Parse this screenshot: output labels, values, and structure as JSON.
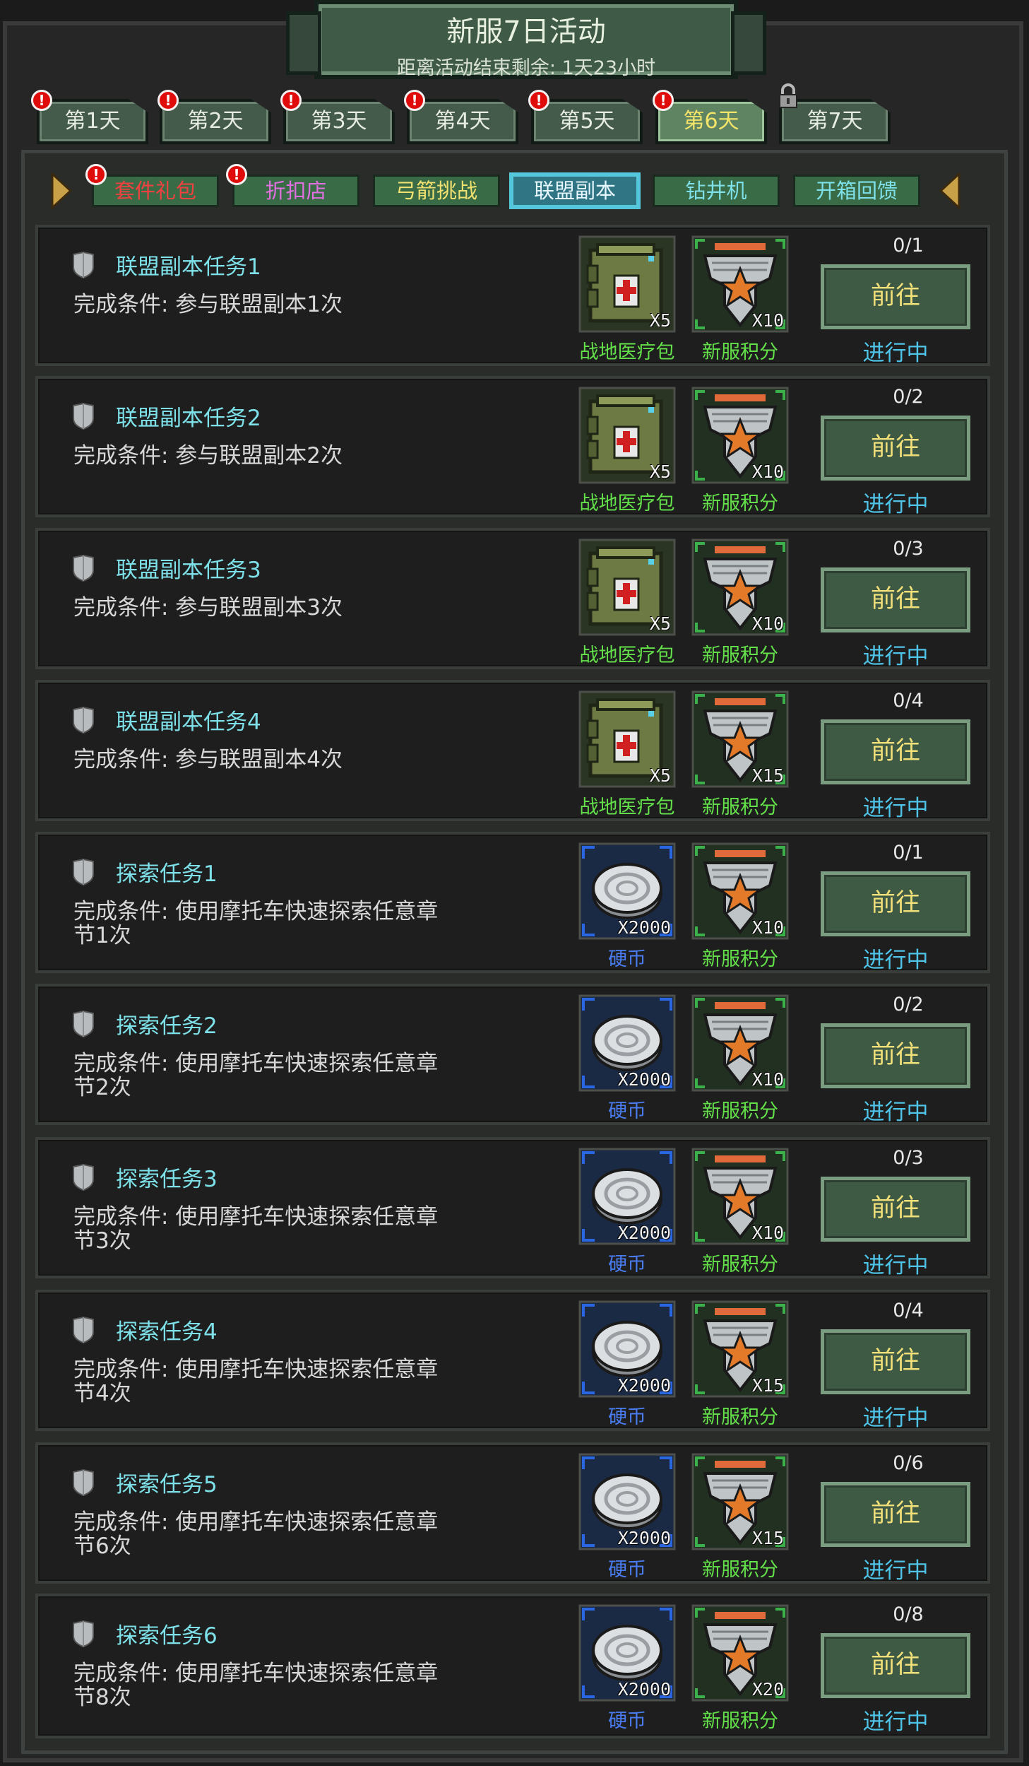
{
  "header": {
    "title": "新服7日活动",
    "countdown": "距离活动结束剩余: 1天23小时"
  },
  "day_tabs": [
    {
      "label": "第1天",
      "alert": true
    },
    {
      "label": "第2天",
      "alert": true
    },
    {
      "label": "第3天",
      "alert": true
    },
    {
      "label": "第4天",
      "alert": true
    },
    {
      "label": "第5天",
      "alert": true
    },
    {
      "label": "第6天",
      "alert": true,
      "active": true
    },
    {
      "label": "第7天",
      "locked": true
    }
  ],
  "alert_mark": "!",
  "sub_tabs": [
    {
      "label": "套件礼包",
      "color": "#f04040",
      "alert": true
    },
    {
      "label": "折扣店",
      "color": "#e070e0",
      "alert": true
    },
    {
      "label": "弓箭挑战",
      "color": "#f0e070"
    },
    {
      "label": "联盟副本",
      "color": "#e8f8ff",
      "active": true
    },
    {
      "label": "钻井机",
      "color": "#7ee0e8"
    },
    {
      "label": "开箱回馈",
      "color": "#7ee0e8"
    }
  ],
  "rewards_meta": {
    "medkit_name": "战地医疗包",
    "points_name": "新服积分",
    "coin_name": "硬币",
    "medkit_name_color": "#63e04a",
    "points_name_color": "#63e04a",
    "coin_name_color": "#4a7cf0"
  },
  "tasks": [
    {
      "name": "联盟副本任务1",
      "condition": "完成条件: 参与联盟副本1次",
      "reward1": {
        "type": "medkit",
        "qty": "X5"
      },
      "reward2": {
        "type": "points",
        "qty": "X10"
      },
      "progress": "0/1",
      "button": "前往",
      "status": "进行中"
    },
    {
      "name": "联盟副本任务2",
      "condition": "完成条件: 参与联盟副本2次",
      "reward1": {
        "type": "medkit",
        "qty": "X5"
      },
      "reward2": {
        "type": "points",
        "qty": "X10"
      },
      "progress": "0/2",
      "button": "前往",
      "status": "进行中"
    },
    {
      "name": "联盟副本任务3",
      "condition": "完成条件: 参与联盟副本3次",
      "reward1": {
        "type": "medkit",
        "qty": "X5"
      },
      "reward2": {
        "type": "points",
        "qty": "X10"
      },
      "progress": "0/3",
      "button": "前往",
      "status": "进行中"
    },
    {
      "name": "联盟副本任务4",
      "condition": "完成条件: 参与联盟副本4次",
      "reward1": {
        "type": "medkit",
        "qty": "X5"
      },
      "reward2": {
        "type": "points",
        "qty": "X15"
      },
      "progress": "0/4",
      "button": "前往",
      "status": "进行中"
    },
    {
      "name": "探索任务1",
      "condition": "完成条件: 使用摩托车快速探索任意章节1次",
      "reward1": {
        "type": "coin",
        "qty": "X2000"
      },
      "reward2": {
        "type": "points",
        "qty": "X10"
      },
      "progress": "0/1",
      "button": "前往",
      "status": "进行中"
    },
    {
      "name": "探索任务2",
      "condition": "完成条件: 使用摩托车快速探索任意章节2次",
      "reward1": {
        "type": "coin",
        "qty": "X2000"
      },
      "reward2": {
        "type": "points",
        "qty": "X10"
      },
      "progress": "0/2",
      "button": "前往",
      "status": "进行中"
    },
    {
      "name": "探索任务3",
      "condition": "完成条件: 使用摩托车快速探索任意章节3次",
      "reward1": {
        "type": "coin",
        "qty": "X2000"
      },
      "reward2": {
        "type": "points",
        "qty": "X10"
      },
      "progress": "0/3",
      "button": "前往",
      "status": "进行中"
    },
    {
      "name": "探索任务4",
      "condition": "完成条件: 使用摩托车快速探索任意章节4次",
      "reward1": {
        "type": "coin",
        "qty": "X2000"
      },
      "reward2": {
        "type": "points",
        "qty": "X15"
      },
      "progress": "0/4",
      "button": "前往",
      "status": "进行中"
    },
    {
      "name": "探索任务5",
      "condition": "完成条件: 使用摩托车快速探索任意章节6次",
      "reward1": {
        "type": "coin",
        "qty": "X2000"
      },
      "reward2": {
        "type": "points",
        "qty": "X15"
      },
      "progress": "0/6",
      "button": "前往",
      "status": "进行中"
    },
    {
      "name": "探索任务6",
      "condition": "完成条件: 使用摩托车快速探索任意章节8次",
      "reward1": {
        "type": "coin",
        "qty": "X2000"
      },
      "reward2": {
        "type": "points",
        "qty": "X20"
      },
      "progress": "0/8",
      "button": "前往",
      "status": "进行中"
    }
  ]
}
